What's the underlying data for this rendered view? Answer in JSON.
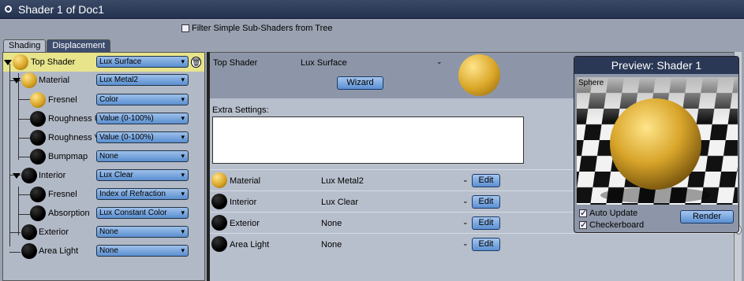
{
  "window": {
    "title": "Shader 1 of Doc1"
  },
  "filter": {
    "label": "Filter Simple Sub-Shaders from Tree",
    "checked": false
  },
  "tabs": [
    {
      "label": "Shading"
    },
    {
      "label": "Displacement"
    }
  ],
  "tree": {
    "top": {
      "label": "Top Shader",
      "value": "Lux Surface"
    },
    "material": {
      "label": "Material",
      "value": "Lux Metal2"
    },
    "fresnel": {
      "label": "Fresnel",
      "value": "Color"
    },
    "rough_u": {
      "label": "Roughness U",
      "value": "Value (0-100%)"
    },
    "rough_v": {
      "label": "Roughness V",
      "value": "Value (0-100%)"
    },
    "bumpmap": {
      "label": "Bumpmap",
      "value": "None"
    },
    "interior": {
      "label": "Interior",
      "value": "Lux Clear"
    },
    "int_fresnel": {
      "label": "Fresnel",
      "value": "Index of Refraction"
    },
    "absorption": {
      "label": "Absorption",
      "value": "Lux Constant Color"
    },
    "exterior": {
      "label": "Exterior",
      "value": "None"
    },
    "area_light": {
      "label": "Area Light",
      "value": "None"
    }
  },
  "props": {
    "top_label": "Top Shader",
    "top_value": "Lux Surface",
    "wizard_label": "Wizard",
    "extra_label": "Extra Settings:",
    "edit_label": "Edit",
    "rows": [
      {
        "label": "Material",
        "value": "Lux Metal2"
      },
      {
        "label": "Interior",
        "value": "Lux Clear"
      },
      {
        "label": "Exterior",
        "value": "None"
      },
      {
        "label": "Area Light",
        "value": "None"
      }
    ]
  },
  "preview": {
    "title": "Preview: Shader 1",
    "scene_label": "Sphere",
    "auto_update": "Auto Update",
    "checkerboard": "Checkerboard",
    "render_label": "Render"
  }
}
